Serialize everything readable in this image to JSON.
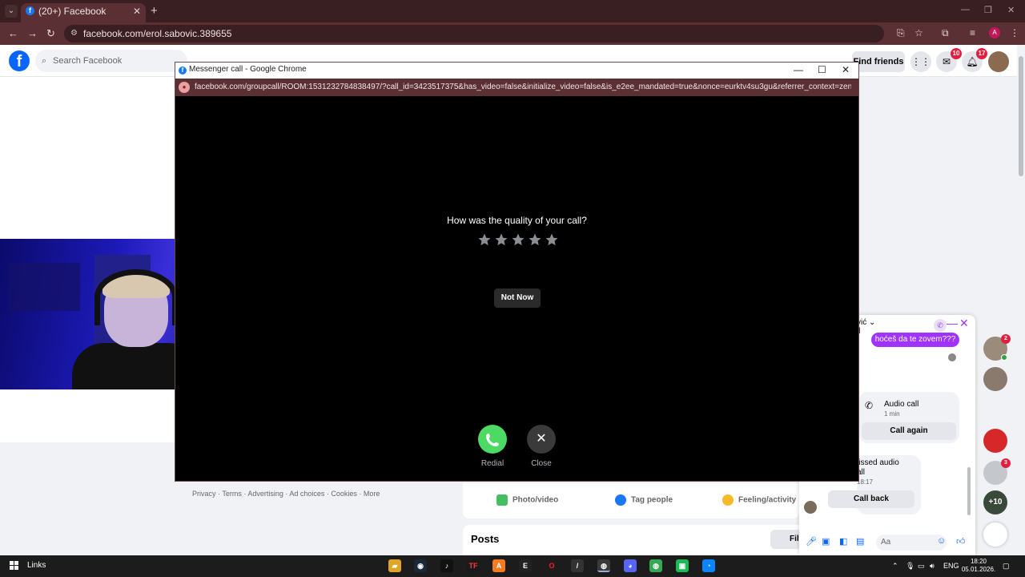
{
  "browser": {
    "tab_title": "(20+) Facebook",
    "url": "facebook.com/erol.sabovic.389655"
  },
  "facebook": {
    "search_placeholder": "Search Facebook",
    "find_friends": "Find friends",
    "messenger_badge": "10",
    "notifications_badge": "17",
    "footer_links": "Privacy · Terms · Advertising · Ad choices   · Cookies · More",
    "composer": {
      "photo_video": "Photo/video",
      "tag_people": "Tag people",
      "feeling": "Feeling/activity"
    },
    "posts_title": "Posts",
    "filters_label": "Filt"
  },
  "chat": {
    "name_fragment": "vić",
    "name_sub": "ll",
    "sent_message": "hoćeš da te zovem???",
    "call_title": "Audio call",
    "call_duration": "1 min",
    "call_again": "Call again",
    "missed_line1": "lissed audio",
    "missed_line2": "all",
    "missed_time": "18:17",
    "call_back": "Call back",
    "input_placeholder": "Aa"
  },
  "contacts": {
    "badge_first": "2",
    "badge_second": "3",
    "more_count": "+10"
  },
  "popup": {
    "window_title": "Messenger call - Google Chrome",
    "url": "facebook.com/groupcall/ROOM:1531232784838497/?call_id=3423517375&has_video=false&initialize_video=false&is_e2ee_mandated=true&nonce=eurktv4su3gu&referrer_context=zenon_precall...",
    "rating_question": "How was the quality of your call?",
    "rating_stars": 0,
    "not_now": "Not Now",
    "redial_label": "Redial",
    "close_label": "Close"
  },
  "taskbar": {
    "links_label": "Links",
    "lang": "ENG",
    "time": "18:20",
    "date": "05.01.2026."
  }
}
